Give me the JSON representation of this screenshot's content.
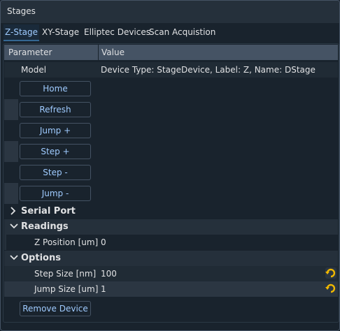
{
  "window": {
    "title": "Stages"
  },
  "tabs": [
    {
      "label": "Z-Stage"
    },
    {
      "label": "XY-Stage"
    },
    {
      "label": "Elliptec Devices"
    },
    {
      "label": "Scan Acquistion"
    }
  ],
  "table": {
    "col_parameter": "Parameter",
    "col_value": "Value",
    "model_label": "Model",
    "model_value": "Device Type: StageDevice, Label: Z, Name: DStage",
    "buttons": [
      "Home",
      "Refresh",
      "Jump +",
      "Step +",
      "Step -",
      "Jump -"
    ],
    "groups": {
      "serial": "Serial Port",
      "readings": "Readings",
      "options": "Options"
    },
    "z_pos_label": "Z Position [um]",
    "z_pos_value": "0",
    "step_label": "Step Size [nm]",
    "step_value": "100",
    "jump_label": "Jump Size [um]",
    "jump_value": "1",
    "remove_button": "Remove Device"
  }
}
